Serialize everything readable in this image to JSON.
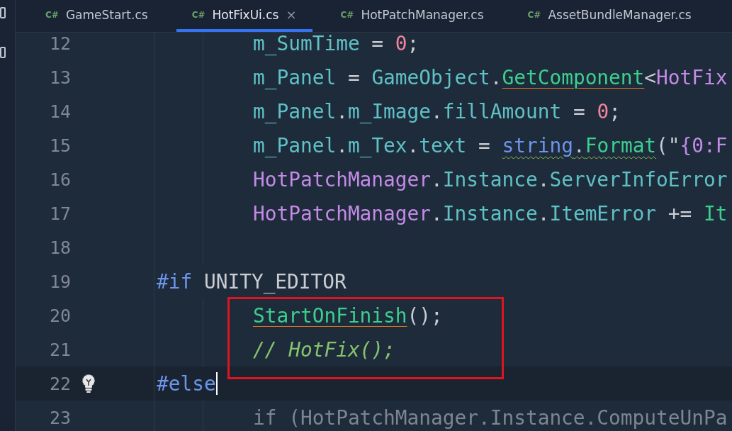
{
  "tabs": [
    {
      "lang": "C#",
      "label": "GameStart.cs",
      "selected": false,
      "closable": false
    },
    {
      "lang": "C#",
      "label": "HotFixUi.cs",
      "selected": true,
      "closable": true
    },
    {
      "lang": "C#",
      "label": "HotPatchManager.cs",
      "selected": false,
      "closable": false
    },
    {
      "lang": "C#",
      "label": "AssetBundleManager.cs",
      "selected": false,
      "closable": false
    }
  ],
  "close_glyph": "×",
  "lines": [
    {
      "number": "12",
      "kind": "code",
      "current": false,
      "boxed": false,
      "tokens": [
        {
          "t": "m_SumTime",
          "kind": "field"
        },
        {
          "t": " = ",
          "kind": "punct"
        },
        {
          "t": "0",
          "kind": "number"
        },
        {
          "t": ";",
          "kind": "punct"
        }
      ]
    },
    {
      "number": "13",
      "kind": "code",
      "current": false,
      "boxed": false,
      "tokens": [
        {
          "t": "m_Panel",
          "kind": "field"
        },
        {
          "t": " = ",
          "kind": "punct"
        },
        {
          "t": "GameObject",
          "kind": "field"
        },
        {
          "t": ".",
          "kind": "punct"
        },
        {
          "t": "GetComponent",
          "kind": "method_warned"
        },
        {
          "t": "<",
          "kind": "punct"
        },
        {
          "t": "HotFix",
          "kind": "type"
        }
      ]
    },
    {
      "number": "14",
      "kind": "code",
      "current": false,
      "boxed": false,
      "tokens": [
        {
          "t": "m_Panel",
          "kind": "field"
        },
        {
          "t": ".",
          "kind": "punct"
        },
        {
          "t": "m_Image",
          "kind": "field"
        },
        {
          "t": ".",
          "kind": "punct"
        },
        {
          "t": "fillAmount",
          "kind": "field"
        },
        {
          "t": " = ",
          "kind": "punct"
        },
        {
          "t": "0",
          "kind": "number"
        },
        {
          "t": ";",
          "kind": "punct"
        }
      ]
    },
    {
      "number": "15",
      "kind": "code",
      "current": false,
      "boxed": false,
      "tokens": [
        {
          "t": "m_Panel",
          "kind": "field"
        },
        {
          "t": ".",
          "kind": "punct"
        },
        {
          "t": "m_Tex",
          "kind": "field"
        },
        {
          "t": ".",
          "kind": "punct"
        },
        {
          "t": "text",
          "kind": "field"
        },
        {
          "t": " = ",
          "kind": "punct"
        },
        {
          "t": "string",
          "kind": "keyword_hinted"
        },
        {
          "t": ".",
          "kind": "punct_hinted"
        },
        {
          "t": "Format",
          "kind": "method_hinted"
        },
        {
          "t": "(\"",
          "kind": "punct"
        },
        {
          "t": "{0:F",
          "kind": "type"
        }
      ]
    },
    {
      "number": "16",
      "kind": "code",
      "current": false,
      "boxed": false,
      "tokens": [
        {
          "t": "HotPatchManager",
          "kind": "type"
        },
        {
          "t": ".",
          "kind": "punct"
        },
        {
          "t": "Instance",
          "kind": "field"
        },
        {
          "t": ".",
          "kind": "punct"
        },
        {
          "t": "ServerInfoError",
          "kind": "field"
        }
      ]
    },
    {
      "number": "17",
      "kind": "code",
      "current": false,
      "boxed": false,
      "tokens": [
        {
          "t": "HotPatchManager",
          "kind": "type"
        },
        {
          "t": ".",
          "kind": "punct"
        },
        {
          "t": "Instance",
          "kind": "field"
        },
        {
          "t": ".",
          "kind": "punct"
        },
        {
          "t": "ItemError",
          "kind": "field"
        },
        {
          "t": " += ",
          "kind": "punct"
        },
        {
          "t": "It",
          "kind": "method"
        }
      ]
    },
    {
      "number": "18",
      "kind": "blank",
      "current": false,
      "boxed": false
    },
    {
      "number": "19",
      "kind": "directive",
      "current": false,
      "boxed": false,
      "tokens": [
        {
          "t": "#if",
          "kind": "keyword"
        },
        {
          "t": " UNITY_EDITOR",
          "kind": "punct"
        }
      ]
    },
    {
      "number": "20",
      "kind": "code",
      "current": false,
      "boxed": true,
      "tokens": [
        {
          "t": "StartOnFinish",
          "kind": "method_warned"
        },
        {
          "t": "();",
          "kind": "punct"
        }
      ]
    },
    {
      "number": "21",
      "kind": "code",
      "current": false,
      "boxed": true,
      "tokens": [
        {
          "t": "// HotFix();",
          "kind": "comment"
        }
      ]
    },
    {
      "number": "22",
      "kind": "directive",
      "current": true,
      "boxed": false,
      "tokens": [
        {
          "t": "#else",
          "kind": "keyword"
        }
      ]
    },
    {
      "number": "23",
      "kind": "code",
      "current": false,
      "boxed": false,
      "tokens": [
        {
          "t": "if (HotPatchManager.Instance.ComputeUnPa",
          "kind": "inactive"
        }
      ]
    }
  ]
}
